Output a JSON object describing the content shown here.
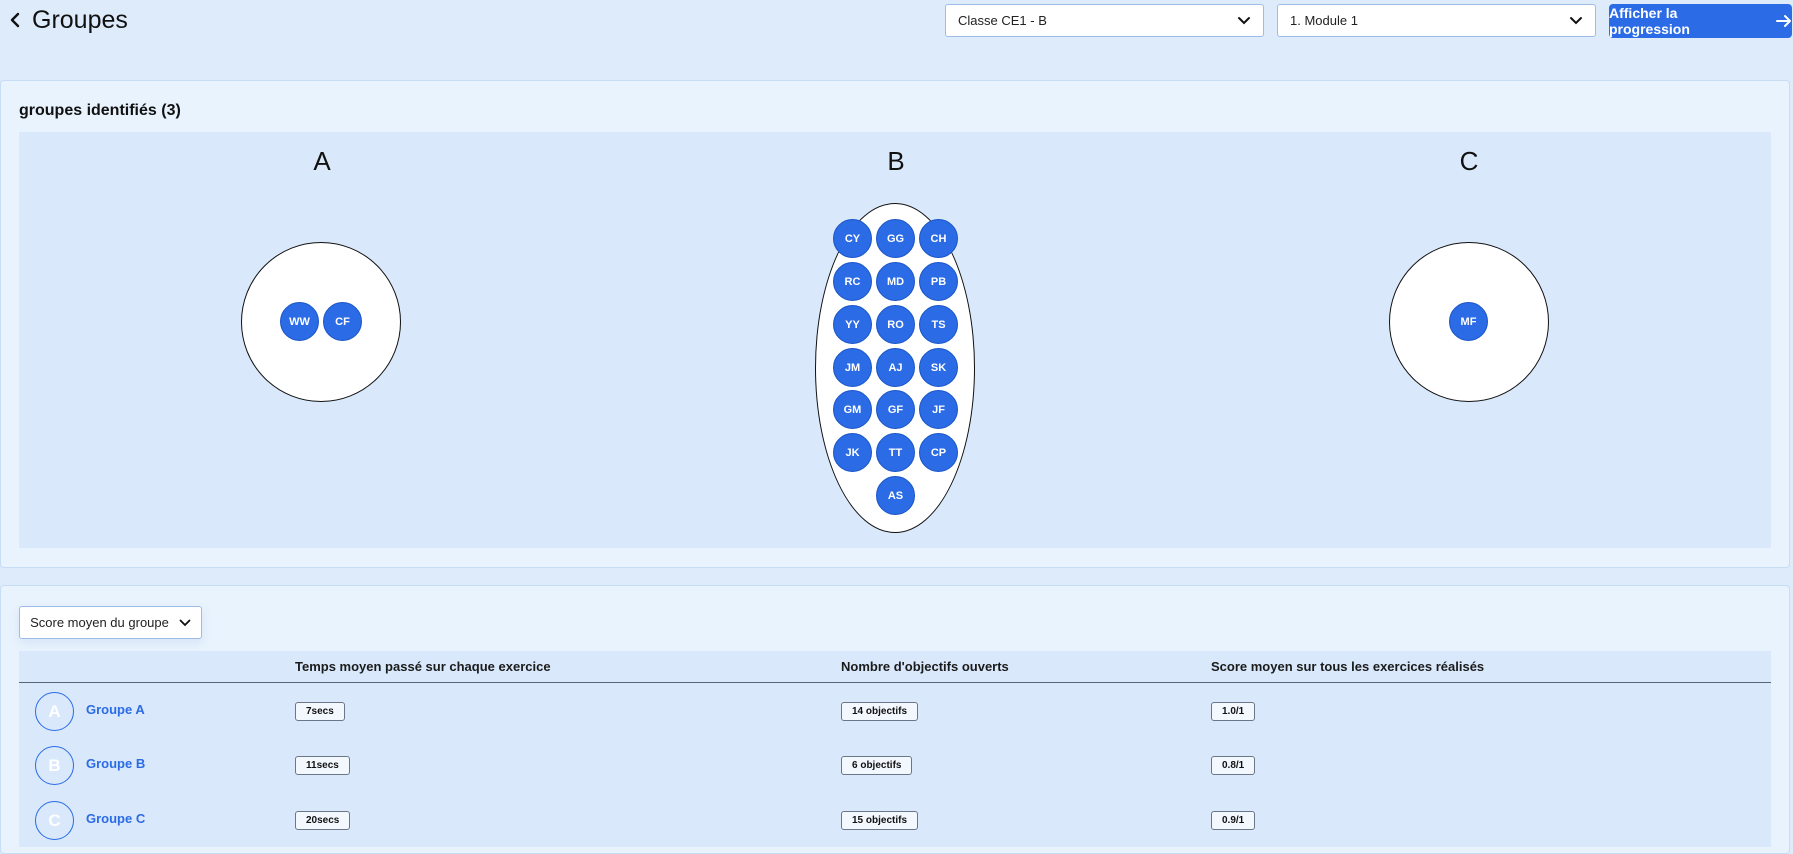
{
  "header": {
    "title": "Groupes",
    "class_select": "Classe CE1 - B",
    "module_select": "1. Module 1",
    "progress_button": "Afficher la progression"
  },
  "groups_panel": {
    "heading": "groupes identifiés (3)",
    "groups": [
      {
        "letter": "A",
        "students": [
          "WW",
          "CF"
        ]
      },
      {
        "letter": "B",
        "students": [
          "CY",
          "GG",
          "CH",
          "RC",
          "MD",
          "PB",
          "YY",
          "RO",
          "TS",
          "JM",
          "AJ",
          "SK",
          "GM",
          "GF",
          "JF",
          "JK",
          "TT",
          "CP",
          "AS"
        ]
      },
      {
        "letter": "C",
        "students": [
          "MF"
        ]
      }
    ]
  },
  "table_panel": {
    "metric_select": "Score moyen du groupe",
    "columns": [
      "Temps moyen passé sur chaque exercice",
      "Nombre d'objectifs ouverts",
      "Score moyen sur tous les exercices réalisés"
    ],
    "rows": [
      {
        "avatar": "A",
        "name": "Groupe A",
        "time": "7secs",
        "objectives": "14 objectifs",
        "score": "1.0/1"
      },
      {
        "avatar": "B",
        "name": "Groupe B",
        "time": "11secs",
        "objectives": "6 objectifs",
        "score": "0.8/1"
      },
      {
        "avatar": "C",
        "name": "Groupe C",
        "time": "20secs",
        "objectives": "15 objectifs",
        "score": "0.9/1"
      }
    ]
  },
  "colors": {
    "accent": "#2b6be6",
    "background": "#ddebfb",
    "panel": "#e9f3fe"
  }
}
